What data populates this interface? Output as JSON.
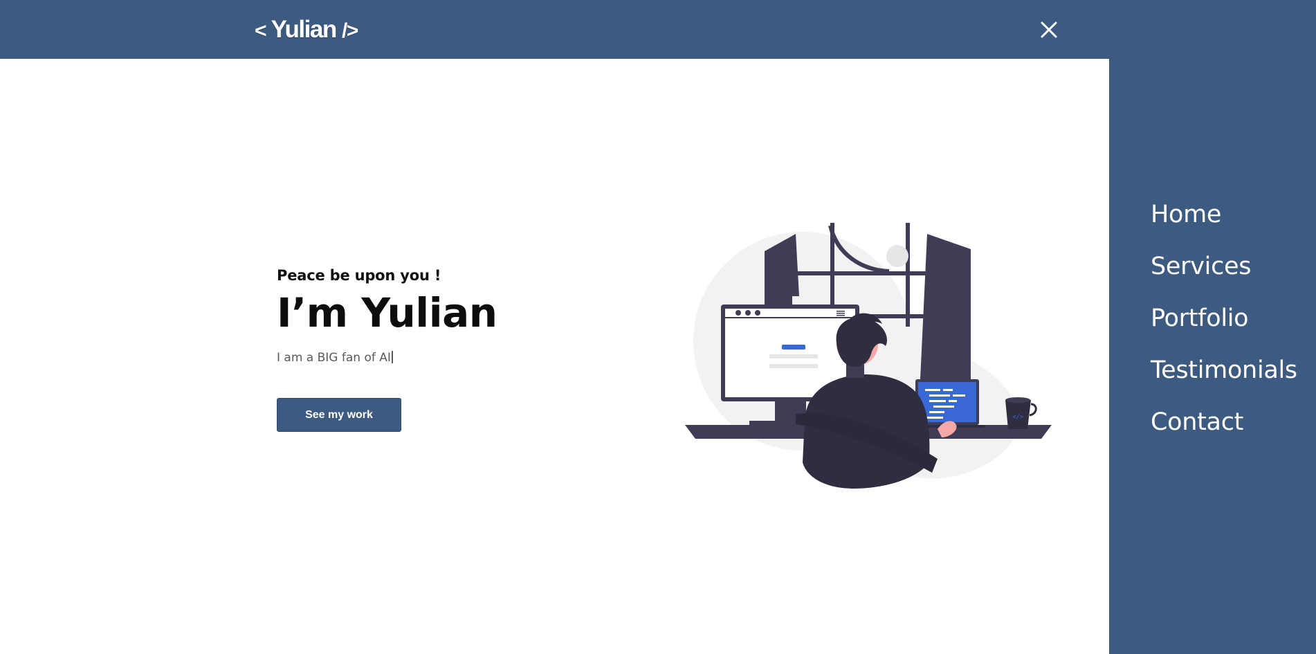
{
  "header": {
    "logo_open": "<",
    "logo_name": " Yulian ",
    "logo_close": "/>",
    "close_icon": "close-icon"
  },
  "menu": {
    "items": [
      {
        "label": "Home"
      },
      {
        "label": "Services"
      },
      {
        "label": "Portfolio"
      },
      {
        "label": "Testimonials"
      },
      {
        "label": "Contact"
      }
    ]
  },
  "hero": {
    "greeting": "Peace be upon you !",
    "name": "I’m Yulian",
    "tagline": "I am a  BIG fan of AI",
    "cta_label": "See my work"
  },
  "colors": {
    "brand": "#3d5a80",
    "illustration_dark": "#3f3d56",
    "illustration_accent": "#3a68d4",
    "skin": "#f5a9a6",
    "background_blob": "#f2f2f2"
  }
}
